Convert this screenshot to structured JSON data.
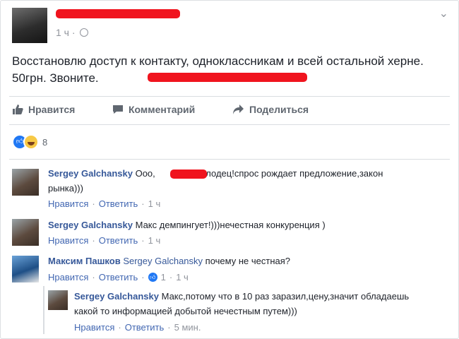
{
  "post": {
    "time": "1 ч",
    "text_main": "Восстановлю доступ к контакту, одноклассникам и всей остальной херне. 50грн. Звоните.",
    "actions": {
      "like": "Нравится",
      "comment": "Комментарий",
      "share": "Поделиться"
    },
    "reaction_count": "8"
  },
  "comments": [
    {
      "name": "Sergey Galchansky",
      "text_before": "Ооо,",
      "text_after": " молодец!спрос рождает предложение,закон рынка)))",
      "like": "Нравится",
      "reply": "Ответить",
      "time": "1 ч"
    },
    {
      "name": "Sergey Galchansky",
      "text": "Макс демпингует!)))нечестная конкуренция )",
      "like": "Нравится",
      "reply": "Ответить",
      "time": "1 ч"
    },
    {
      "name": "Максим Пашков",
      "tag": "Sergey Galchansky",
      "text": "почему не честная?",
      "like": "Нравится",
      "reply": "Ответить",
      "likes": "1",
      "time": "1 ч"
    }
  ],
  "reply": {
    "name": "Sergey Galchansky",
    "text": "Макс,потому что в 10 раз заразил,цену,значит обладаешь какой то информацией добытой нечестным путем)))",
    "like": "Нравится",
    "reply": "Ответить",
    "time": "5 мин."
  },
  "sep": "·"
}
